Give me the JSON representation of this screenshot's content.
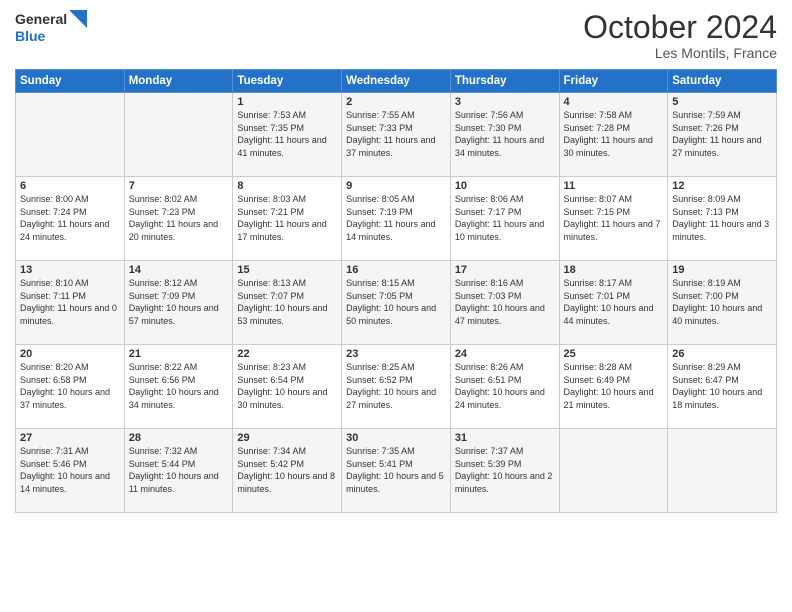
{
  "logo": {
    "line1": "General",
    "line2": "Blue"
  },
  "title": "October 2024",
  "location": "Les Montils, France",
  "days_of_week": [
    "Sunday",
    "Monday",
    "Tuesday",
    "Wednesday",
    "Thursday",
    "Friday",
    "Saturday"
  ],
  "weeks": [
    [
      {
        "day": "",
        "sunrise": "",
        "sunset": "",
        "daylight": ""
      },
      {
        "day": "",
        "sunrise": "",
        "sunset": "",
        "daylight": ""
      },
      {
        "day": "1",
        "sunrise": "Sunrise: 7:53 AM",
        "sunset": "Sunset: 7:35 PM",
        "daylight": "Daylight: 11 hours and 41 minutes."
      },
      {
        "day": "2",
        "sunrise": "Sunrise: 7:55 AM",
        "sunset": "Sunset: 7:33 PM",
        "daylight": "Daylight: 11 hours and 37 minutes."
      },
      {
        "day": "3",
        "sunrise": "Sunrise: 7:56 AM",
        "sunset": "Sunset: 7:30 PM",
        "daylight": "Daylight: 11 hours and 34 minutes."
      },
      {
        "day": "4",
        "sunrise": "Sunrise: 7:58 AM",
        "sunset": "Sunset: 7:28 PM",
        "daylight": "Daylight: 11 hours and 30 minutes."
      },
      {
        "day": "5",
        "sunrise": "Sunrise: 7:59 AM",
        "sunset": "Sunset: 7:26 PM",
        "daylight": "Daylight: 11 hours and 27 minutes."
      }
    ],
    [
      {
        "day": "6",
        "sunrise": "Sunrise: 8:00 AM",
        "sunset": "Sunset: 7:24 PM",
        "daylight": "Daylight: 11 hours and 24 minutes."
      },
      {
        "day": "7",
        "sunrise": "Sunrise: 8:02 AM",
        "sunset": "Sunset: 7:23 PM",
        "daylight": "Daylight: 11 hours and 20 minutes."
      },
      {
        "day": "8",
        "sunrise": "Sunrise: 8:03 AM",
        "sunset": "Sunset: 7:21 PM",
        "daylight": "Daylight: 11 hours and 17 minutes."
      },
      {
        "day": "9",
        "sunrise": "Sunrise: 8:05 AM",
        "sunset": "Sunset: 7:19 PM",
        "daylight": "Daylight: 11 hours and 14 minutes."
      },
      {
        "day": "10",
        "sunrise": "Sunrise: 8:06 AM",
        "sunset": "Sunset: 7:17 PM",
        "daylight": "Daylight: 11 hours and 10 minutes."
      },
      {
        "day": "11",
        "sunrise": "Sunrise: 8:07 AM",
        "sunset": "Sunset: 7:15 PM",
        "daylight": "Daylight: 11 hours and 7 minutes."
      },
      {
        "day": "12",
        "sunrise": "Sunrise: 8:09 AM",
        "sunset": "Sunset: 7:13 PM",
        "daylight": "Daylight: 11 hours and 3 minutes."
      }
    ],
    [
      {
        "day": "13",
        "sunrise": "Sunrise: 8:10 AM",
        "sunset": "Sunset: 7:11 PM",
        "daylight": "Daylight: 11 hours and 0 minutes."
      },
      {
        "day": "14",
        "sunrise": "Sunrise: 8:12 AM",
        "sunset": "Sunset: 7:09 PM",
        "daylight": "Daylight: 10 hours and 57 minutes."
      },
      {
        "day": "15",
        "sunrise": "Sunrise: 8:13 AM",
        "sunset": "Sunset: 7:07 PM",
        "daylight": "Daylight: 10 hours and 53 minutes."
      },
      {
        "day": "16",
        "sunrise": "Sunrise: 8:15 AM",
        "sunset": "Sunset: 7:05 PM",
        "daylight": "Daylight: 10 hours and 50 minutes."
      },
      {
        "day": "17",
        "sunrise": "Sunrise: 8:16 AM",
        "sunset": "Sunset: 7:03 PM",
        "daylight": "Daylight: 10 hours and 47 minutes."
      },
      {
        "day": "18",
        "sunrise": "Sunrise: 8:17 AM",
        "sunset": "Sunset: 7:01 PM",
        "daylight": "Daylight: 10 hours and 44 minutes."
      },
      {
        "day": "19",
        "sunrise": "Sunrise: 8:19 AM",
        "sunset": "Sunset: 7:00 PM",
        "daylight": "Daylight: 10 hours and 40 minutes."
      }
    ],
    [
      {
        "day": "20",
        "sunrise": "Sunrise: 8:20 AM",
        "sunset": "Sunset: 6:58 PM",
        "daylight": "Daylight: 10 hours and 37 minutes."
      },
      {
        "day": "21",
        "sunrise": "Sunrise: 8:22 AM",
        "sunset": "Sunset: 6:56 PM",
        "daylight": "Daylight: 10 hours and 34 minutes."
      },
      {
        "day": "22",
        "sunrise": "Sunrise: 8:23 AM",
        "sunset": "Sunset: 6:54 PM",
        "daylight": "Daylight: 10 hours and 30 minutes."
      },
      {
        "day": "23",
        "sunrise": "Sunrise: 8:25 AM",
        "sunset": "Sunset: 6:52 PM",
        "daylight": "Daylight: 10 hours and 27 minutes."
      },
      {
        "day": "24",
        "sunrise": "Sunrise: 8:26 AM",
        "sunset": "Sunset: 6:51 PM",
        "daylight": "Daylight: 10 hours and 24 minutes."
      },
      {
        "day": "25",
        "sunrise": "Sunrise: 8:28 AM",
        "sunset": "Sunset: 6:49 PM",
        "daylight": "Daylight: 10 hours and 21 minutes."
      },
      {
        "day": "26",
        "sunrise": "Sunrise: 8:29 AM",
        "sunset": "Sunset: 6:47 PM",
        "daylight": "Daylight: 10 hours and 18 minutes."
      }
    ],
    [
      {
        "day": "27",
        "sunrise": "Sunrise: 7:31 AM",
        "sunset": "Sunset: 5:46 PM",
        "daylight": "Daylight: 10 hours and 14 minutes."
      },
      {
        "day": "28",
        "sunrise": "Sunrise: 7:32 AM",
        "sunset": "Sunset: 5:44 PM",
        "daylight": "Daylight: 10 hours and 11 minutes."
      },
      {
        "day": "29",
        "sunrise": "Sunrise: 7:34 AM",
        "sunset": "Sunset: 5:42 PM",
        "daylight": "Daylight: 10 hours and 8 minutes."
      },
      {
        "day": "30",
        "sunrise": "Sunrise: 7:35 AM",
        "sunset": "Sunset: 5:41 PM",
        "daylight": "Daylight: 10 hours and 5 minutes."
      },
      {
        "day": "31",
        "sunrise": "Sunrise: 7:37 AM",
        "sunset": "Sunset: 5:39 PM",
        "daylight": "Daylight: 10 hours and 2 minutes."
      },
      {
        "day": "",
        "sunrise": "",
        "sunset": "",
        "daylight": ""
      },
      {
        "day": "",
        "sunrise": "",
        "sunset": "",
        "daylight": ""
      }
    ]
  ]
}
